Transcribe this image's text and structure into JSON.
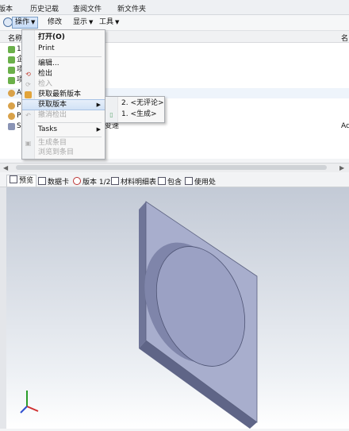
{
  "top_tabs": [
    "版本",
    "历史记载",
    "查阅文件",
    "新文件夹"
  ],
  "toolbar": {
    "items": [
      {
        "label": "操作",
        "active": true
      },
      {
        "label": "修改"
      },
      {
        "label": "显示"
      },
      {
        "label": "工具"
      }
    ]
  },
  "list": {
    "col_name": "名称",
    "col_right": "名",
    "rows": [
      {
        "text": "1",
        "icon": "green-doc-icon"
      },
      {
        "text": "企",
        "icon": "green-doc-icon"
      },
      {
        "text": "项",
        "icon": "green-doc-icon"
      },
      {
        "text": "项",
        "icon": "green-doc-icon"
      },
      {
        "text": "A",
        "icon": "part-icon"
      },
      {
        "text": "P",
        "icon": "part-icon"
      },
      {
        "text": "P",
        "icon": "part-icon"
      },
      {
        "text": "S",
        "icon": "assembly-icon",
        "suffix": "变速",
        "right": "Ac"
      }
    ]
  },
  "menu": {
    "items": [
      {
        "label": "打开(O)",
        "bold": true
      },
      {
        "label": "Print"
      },
      {
        "sep": true
      },
      {
        "label": "编辑..."
      },
      {
        "label": "检出",
        "icon": "checkout-icon"
      },
      {
        "label": "检入",
        "disabled": true,
        "icon": "checkin-icon"
      },
      {
        "label": "获取最新版本",
        "icon": "get-latest-icon"
      },
      {
        "label": "获取版本",
        "highlight": true,
        "submenu": true
      },
      {
        "label": "撤消检出",
        "disabled": true,
        "icon": "undo-checkout-icon"
      },
      {
        "sep": true
      },
      {
        "label": "Tasks",
        "submenu": true
      },
      {
        "sep": true
      },
      {
        "label": "生成条目",
        "disabled": true,
        "icon": "generate-icon"
      },
      {
        "label": "浏览到条目",
        "disabled": true
      }
    ]
  },
  "submenu": {
    "items": [
      "2. <无评论>",
      "1. <生成>"
    ]
  },
  "preview_tabs": [
    "预览",
    "数据卡",
    "版本 1/2",
    "材料明细表",
    "包含",
    "使用处"
  ],
  "colors": {
    "plate_face": "#a8aecd",
    "plate_side": "#6f7598",
    "disk_face": "#9ba1c4",
    "disk_side": "#7f85aa",
    "viewport_top": "#c3cad6"
  }
}
